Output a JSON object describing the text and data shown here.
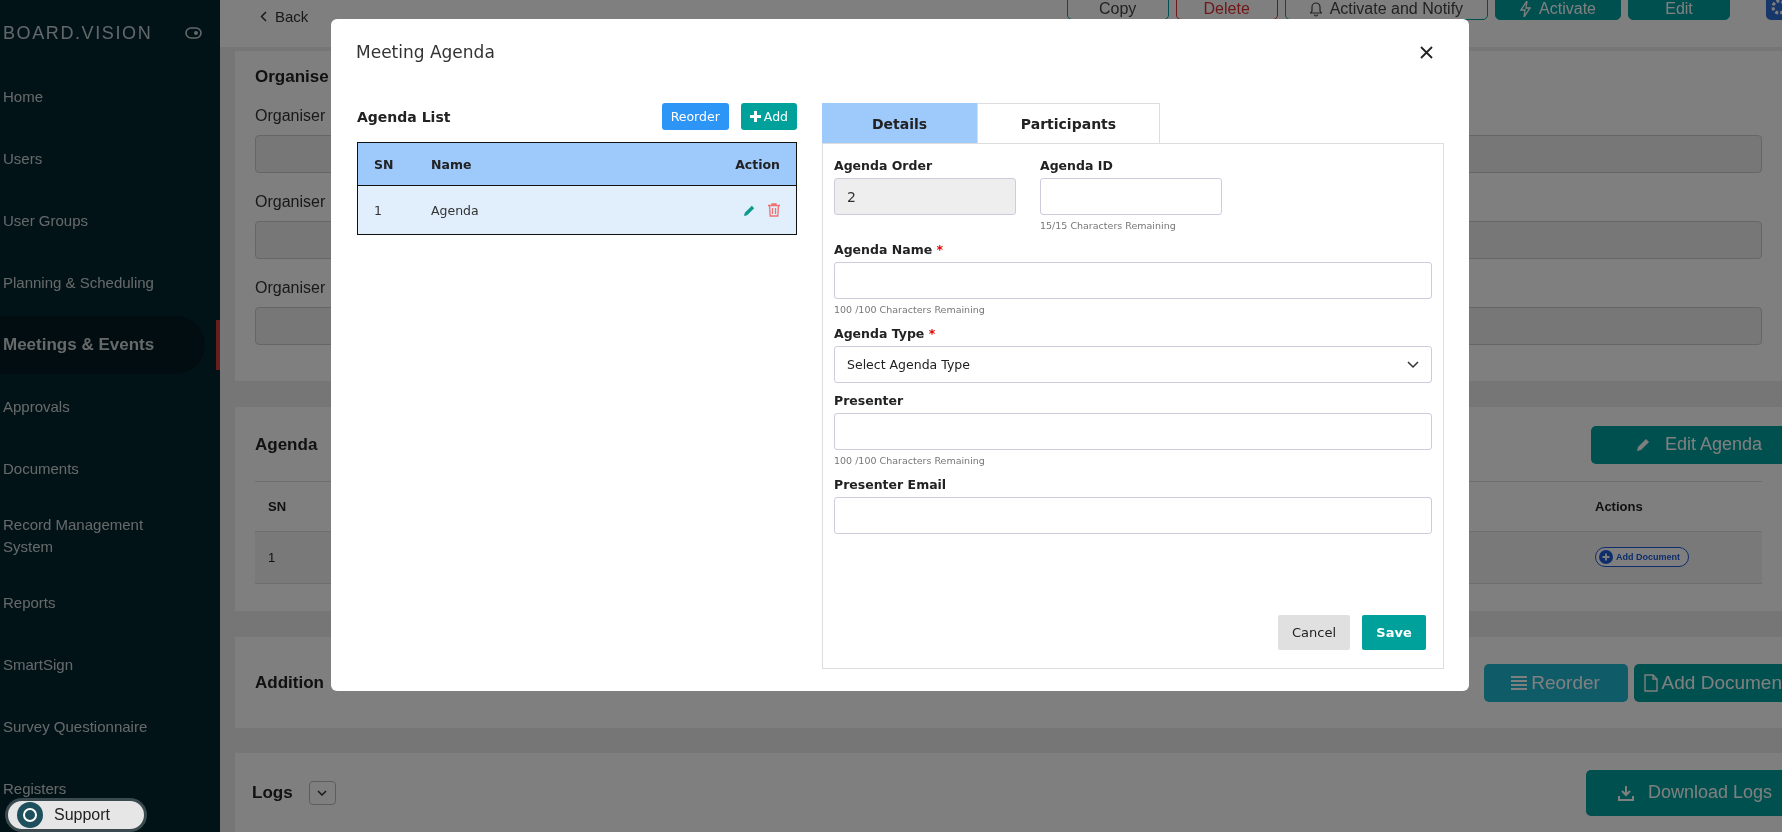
{
  "sidebar": {
    "brand": "BOARD.VISION",
    "items": [
      {
        "label": "Home",
        "selected": false
      },
      {
        "label": "Users",
        "selected": false
      },
      {
        "label": "User Groups",
        "selected": false
      },
      {
        "label": "Planning & Scheduling",
        "selected": false
      },
      {
        "label": "Meetings & Events",
        "selected": true
      },
      {
        "label": "Approvals",
        "selected": false
      },
      {
        "label": "Documents",
        "selected": false
      },
      {
        "label": "Record Management System",
        "selected": false
      },
      {
        "label": "Reports",
        "selected": false
      },
      {
        "label": "SmartSign",
        "selected": false
      },
      {
        "label": "Survey Questionnaire",
        "selected": false
      },
      {
        "label": "Registers",
        "selected": false
      }
    ],
    "support": "Support"
  },
  "topbar": {
    "back": "Back",
    "buttons": [
      {
        "label": "Copy",
        "kind": "outline"
      },
      {
        "label": "Delete",
        "kind": "danger"
      },
      {
        "label": "Activate and Notify",
        "kind": "notify"
      },
      {
        "label": "Activate",
        "kind": "activate"
      },
      {
        "label": "Edit",
        "kind": "primary"
      }
    ]
  },
  "organiser": {
    "title": "Organise",
    "fields": [
      "Organiser",
      "Organiser",
      "Organiser"
    ]
  },
  "agenda_section": {
    "title": "Agenda",
    "edit_button": "Edit Agenda",
    "columns": [
      "SN",
      "Actions"
    ],
    "rows": [
      {
        "sn": "1",
        "action": "Add Document"
      }
    ]
  },
  "additional": {
    "title": "Addition",
    "reorder": "Reorder",
    "add_document": "Add Documen"
  },
  "logs": {
    "title": "Logs",
    "download": "Download Logs"
  },
  "modal": {
    "title": "Meeting Agenda",
    "list": {
      "title": "Agenda List",
      "reorder": "Reorder",
      "add": "Add",
      "columns": [
        "SN",
        "Name",
        "Action"
      ],
      "rows": [
        {
          "sn": "1",
          "name": "Agenda"
        }
      ]
    },
    "tabs": [
      {
        "label": "Details",
        "selected": true
      },
      {
        "label": "Participants",
        "selected": false
      }
    ],
    "field_rows": [
      [
        {
          "label": "Agenda Order",
          "kind": "readonly",
          "value": "2"
        },
        {
          "label": "Agenda ID",
          "kind": "text",
          "hint": "15/15 Characters Remaining"
        }
      ],
      [
        {
          "label": "Agenda Name",
          "marker": "*",
          "kind": "text",
          "hint": "100 /100 Characters Remaining"
        }
      ],
      [
        {
          "label": "Agenda Type",
          "marker": "*",
          "kind": "select",
          "value": "Select Agenda Type"
        }
      ],
      [
        {
          "label": "Presenter",
          "kind": "text",
          "hint": "100 /100 Characters Remaining"
        }
      ],
      [
        {
          "label": "Presenter Email",
          "kind": "text"
        }
      ]
    ],
    "cancel": "Cancel",
    "save": "Save"
  }
}
